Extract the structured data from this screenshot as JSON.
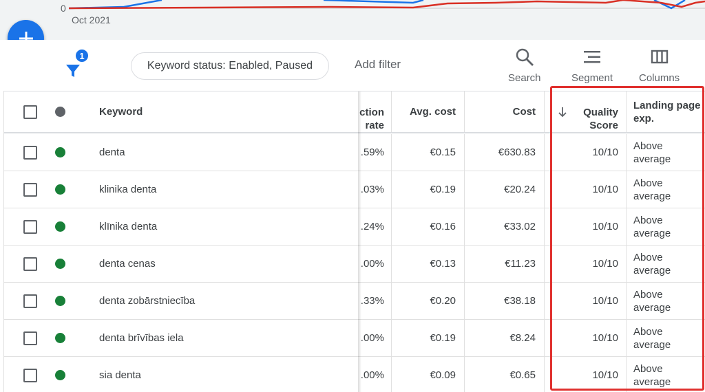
{
  "chart": {
    "y_tick_zero": "0",
    "x_tick_label": "Oct 2021",
    "series_colors": [
      "#1a73e8",
      "#d93025"
    ]
  },
  "fab": {
    "icon": "plus-icon",
    "color": "#1a73e8"
  },
  "toolbar": {
    "filter_count": "1",
    "filter_chip": "Keyword status: Enabled, Paused",
    "add_filter": "Add filter",
    "search_label": "Search",
    "segment_label": "Segment",
    "columns_label": "Columns"
  },
  "table": {
    "headers": {
      "keyword": "Keyword",
      "interaction_rate_line1": "ction",
      "interaction_rate_line2": "rate",
      "avg_cost": "Avg. cost",
      "cost": "Cost",
      "quality_line1": "Quality",
      "quality_line2": "Score",
      "landing_line1": "Landing page",
      "landing_line2": "exp."
    },
    "status_color": "#188038",
    "rows": [
      {
        "keyword": "denta",
        "rate": ".59%",
        "avg_cost": "€0.15",
        "cost": "€630.83",
        "quality": "10/10",
        "lp1": "Above",
        "lp2": "average"
      },
      {
        "keyword": "klinika denta",
        "rate": ".03%",
        "avg_cost": "€0.19",
        "cost": "€20.24",
        "quality": "10/10",
        "lp1": "Above",
        "lp2": "average"
      },
      {
        "keyword": "klīnika denta",
        "rate": ".24%",
        "avg_cost": "€0.16",
        "cost": "€33.02",
        "quality": "10/10",
        "lp1": "Above",
        "lp2": "average"
      },
      {
        "keyword": "denta cenas",
        "rate": ".00%",
        "avg_cost": "€0.13",
        "cost": "€11.23",
        "quality": "10/10",
        "lp1": "Above",
        "lp2": "average"
      },
      {
        "keyword": "denta zobārstniecība",
        "rate": ".33%",
        "avg_cost": "€0.20",
        "cost": "€38.18",
        "quality": "10/10",
        "lp1": "Above",
        "lp2": "average"
      },
      {
        "keyword": "denta brīvības iela",
        "rate": ".00%",
        "avg_cost": "€0.19",
        "cost": "€8.24",
        "quality": "10/10",
        "lp1": "Above",
        "lp2": "average"
      },
      {
        "keyword": "sia denta",
        "rate": ".00%",
        "avg_cost": "€0.09",
        "cost": "€0.65",
        "quality": "10/10",
        "lp1": "Above",
        "lp2": "average"
      }
    ]
  }
}
